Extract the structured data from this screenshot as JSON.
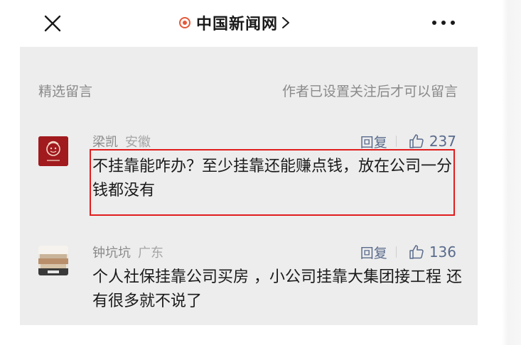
{
  "header": {
    "title": "中国新闻网",
    "chevron": "›",
    "close_icon": "close-icon",
    "more_icon": "more-icon",
    "brand_color": "#e45a3a"
  },
  "section": {
    "title": "精选留言",
    "note": "作者已设置关注后才可以留言"
  },
  "comments": [
    {
      "author": "梁凯",
      "region": "安徽",
      "reply_label": "回复",
      "likes": "237",
      "text": "不挂靠能咋办？至少挂靠还能赚点钱，放在公司一分钱都没有",
      "avatar": "red-cartoon-avatar",
      "highlighted": true
    },
    {
      "author": "钟坑坑",
      "region": "广东",
      "reply_label": "回复",
      "likes": "136",
      "text": "个人社保挂靠公司买房 ，小公司挂靠大集团接工程 还有很多就不说了",
      "avatar": "money-photo-avatar",
      "highlighted": false
    }
  ],
  "colors": {
    "panel_bg": "#ededed",
    "link": "#5a6b8c",
    "highlight": "#e11d1d"
  }
}
